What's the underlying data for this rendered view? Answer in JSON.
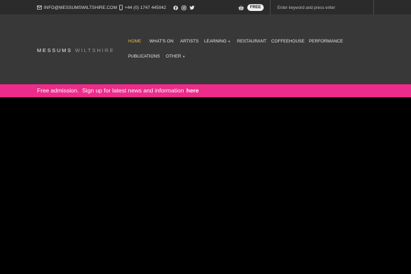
{
  "topbar": {
    "email": "INFO@MESSUMSWILTSHIRE.COM",
    "phone": "+44 (0) 1747 445042",
    "social_icons": [
      "facebook-icon",
      "instagram-icon",
      "twitter-icon"
    ],
    "cart_badge": "FREE",
    "search_placeholder": "Enter keyword and press enter"
  },
  "header": {
    "logo_part1": "MESSUMS",
    "logo_part2": "WILTSHIRE",
    "nav": {
      "home": "HOME",
      "whats_on": "WHAT'S ON",
      "artists": "ARTISTS",
      "learning": "LEARNING",
      "restaurant": "RESTAURANT",
      "coffeehouse": "COFFEEHOUSE",
      "performance": "PERFORMANCE",
      "publications": "PUBLICATIONS",
      "other": "OTHER"
    }
  },
  "banner": {
    "message": "Free admission.  Sign up for latest news and information",
    "link_text": "here"
  },
  "colors": {
    "topbar_bg": "#2b2b2b",
    "header_bg": "#383838",
    "active_nav": "#e9b94a",
    "banner_bg": "#ec2b8a",
    "hero_bg": "#000000"
  }
}
